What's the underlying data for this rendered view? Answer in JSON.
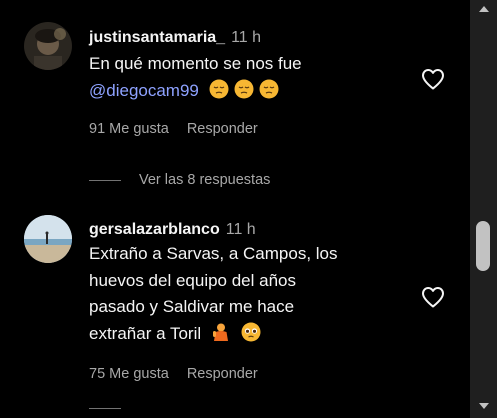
{
  "comments": [
    {
      "username": "justinsantamaria_",
      "time": "11 h",
      "text_line1": "En qué momento se nos fue",
      "mention": "@diegocam99",
      "emojis": [
        "pensive-face",
        "pensive-face",
        "pensive-face"
      ],
      "likes": "91 Me gusta",
      "reply_label": "Responder"
    },
    {
      "username": "gersalazarblanco",
      "time": "11 h",
      "lines": [
        "Extraño a Sarvas, a Campos, los",
        "huevos del equipo del años",
        "pasado y Saldivar me hace",
        "extrañar a Toril"
      ],
      "emojis": [
        "person-gesturing-icon",
        "pleading-face"
      ],
      "likes": "75 Me gusta",
      "reply_label": "Responder"
    }
  ],
  "view_replies": "Ver las 8 respuestas",
  "colors": {
    "background": "#000000",
    "text_primary": "#f5f5f5",
    "text_secondary": "#a8a8a8",
    "mention": "#8ea2ff",
    "scrollbar_track": "#1f1f1f",
    "scrollbar_thumb": "#c2c2c2"
  }
}
